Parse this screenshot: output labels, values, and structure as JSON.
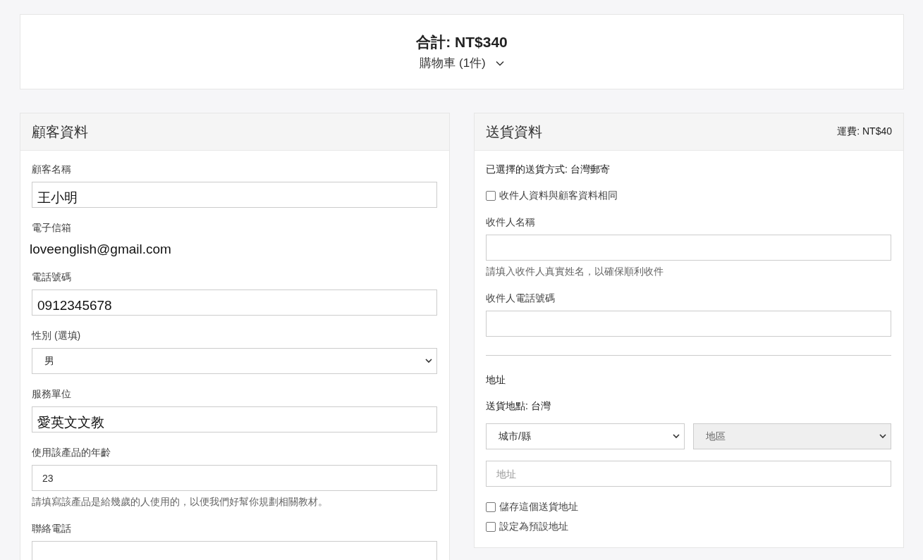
{
  "summary": {
    "total": "合計: NT$340",
    "cart_toggle": "購物車 (1件)",
    "expanded": false
  },
  "customer": {
    "title": "顧客資料",
    "fields": [
      {
        "kind": "input",
        "label": "顧客名稱",
        "value": "王小明"
      },
      {
        "kind": "static",
        "label": "電子信箱",
        "value": "loveenglish@gmail.com"
      },
      {
        "kind": "input",
        "label": "電話號碼",
        "value": "0912345678"
      },
      {
        "kind": "select",
        "label": "性別 (選填)",
        "value": "男"
      },
      {
        "kind": "input",
        "label": "服務單位",
        "value": "愛英文文教"
      },
      {
        "kind": "number",
        "label": "使用該產品的年齡",
        "value": "23",
        "help": "請填寫該產品是給幾歲的人使用的，以便我們好幫你規劃相關教材。"
      },
      {
        "kind": "input",
        "label": "聯絡電話"
      }
    ]
  },
  "shipping": {
    "title": "送貨資料",
    "fee": "運費: NT$40",
    "method": "已選擇的送貨方式: 台灣郵寄",
    "same_as_customer": {
      "label": "收件人資料與顧客資料相同",
      "checked": false
    },
    "fields": [
      {
        "label": "收件人名稱",
        "help": "請填入收件人真實姓名，以確保順利收件"
      },
      {
        "label": "收件人電話號碼"
      }
    ],
    "address_heading": "地址",
    "destination": "送貨地點: 台灣",
    "selects": [
      {
        "value": "城市/縣",
        "disabled": false
      },
      {
        "value": "地區",
        "disabled": true
      }
    ],
    "address_placeholder": "地址",
    "options": [
      {
        "label": "儲存這個送貨地址",
        "checked": false
      },
      {
        "label": "設定為預設地址",
        "checked": false
      }
    ]
  }
}
